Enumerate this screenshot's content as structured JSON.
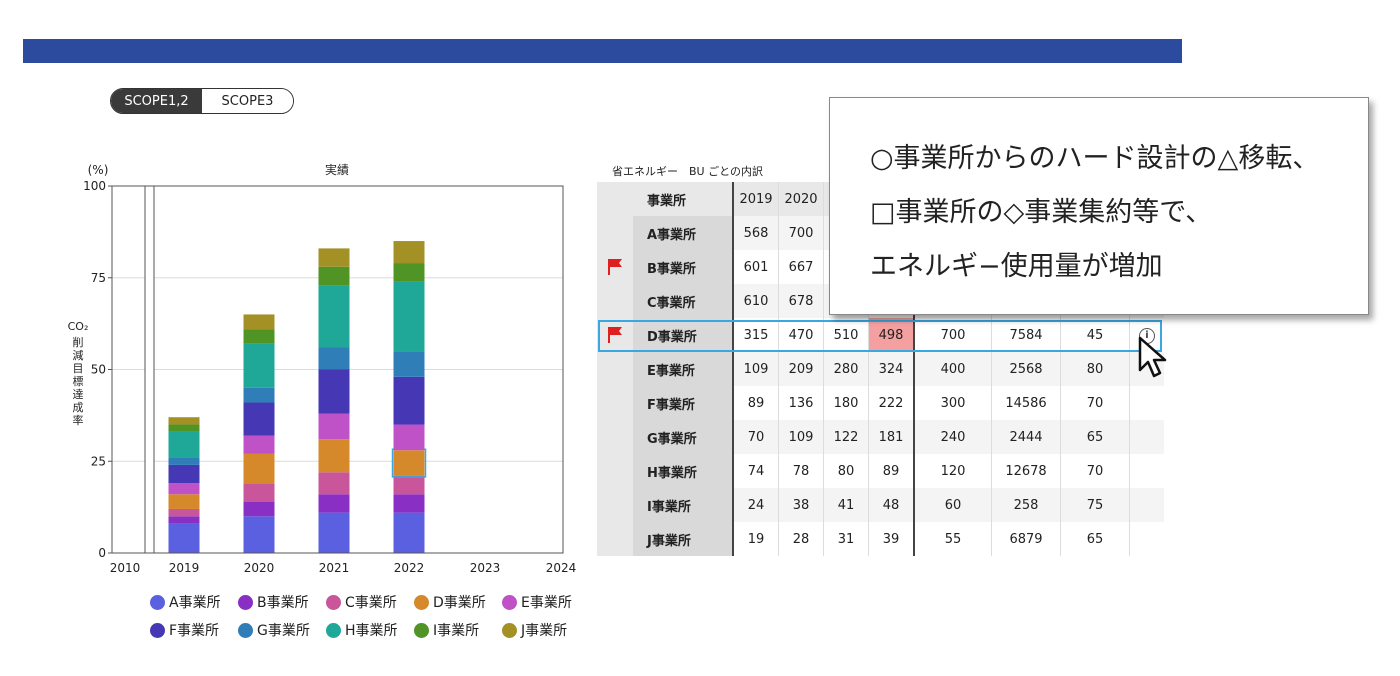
{
  "scope_toggle": {
    "options": [
      "SCOPE1,2",
      "SCOPE3"
    ],
    "selected": "SCOPE1,2"
  },
  "chart_data": {
    "type": "bar",
    "stacked": true,
    "title": "実績",
    "y_unit": "(%)",
    "ylabel": "CO₂ 削減目標達成率",
    "ylim": [
      0,
      100
    ],
    "yticks": [
      0,
      25,
      50,
      75,
      100
    ],
    "x_ticks": [
      "2010",
      "2019",
      "2020",
      "2021",
      "2022",
      "2023",
      "2024"
    ],
    "categories": [
      "2019",
      "2020",
      "2021",
      "2022"
    ],
    "grid": true,
    "legend_position": "bottom",
    "series": [
      {
        "name": "A事業所",
        "color": "#5a60e0",
        "values": [
          8,
          10,
          11,
          11
        ]
      },
      {
        "name": "B事業所",
        "color": "#8a2fc4",
        "values": [
          2,
          4,
          5,
          5
        ]
      },
      {
        "name": "C事業所",
        "color": "#c9559a",
        "values": [
          2,
          5,
          6,
          5
        ]
      },
      {
        "name": "D事業所",
        "color": "#d6892a",
        "values": [
          4,
          8,
          9,
          7
        ]
      },
      {
        "name": "E事業所",
        "color": "#c052c8",
        "values": [
          3,
          5,
          7,
          7
        ]
      },
      {
        "name": "F事業所",
        "color": "#4637b5",
        "values": [
          5,
          9,
          12,
          13
        ]
      },
      {
        "name": "G事業所",
        "color": "#2f7eb8",
        "values": [
          2,
          4,
          6,
          7
        ]
      },
      {
        "name": "H事業所",
        "color": "#1fa897",
        "values": [
          7,
          12,
          17,
          19
        ]
      },
      {
        "name": "I事業所",
        "color": "#4f9425",
        "values": [
          2,
          4,
          5,
          5
        ]
      },
      {
        "name": "J事業所",
        "color": "#a39126",
        "values": [
          2,
          4,
          5,
          6
        ]
      }
    ],
    "highlight": {
      "series": "D事業所",
      "category": "2022",
      "color": "#3aa8e0"
    }
  },
  "table": {
    "title": "省エネルギー　BU ごとの内訳",
    "header_label": "事業所",
    "year_headers": [
      "2019",
      "2020"
    ],
    "rows": [
      {
        "name": "A事業所",
        "flag": false,
        "values": [
          "568",
          "700",
          "",
          "",
          "",
          "",
          ""
        ]
      },
      {
        "name": "B事業所",
        "flag": true,
        "values": [
          "601",
          "667",
          "",
          "",
          "",
          "",
          ""
        ]
      },
      {
        "name": "C事業所",
        "flag": false,
        "values": [
          "610",
          "678",
          "",
          "",
          "",
          "",
          ""
        ]
      },
      {
        "name": "D事業所",
        "flag": true,
        "values": [
          "315",
          "470",
          "510",
          "498",
          "700",
          "7584",
          "45"
        ],
        "highlight_index": 3,
        "info": true
      },
      {
        "name": "E事業所",
        "flag": false,
        "values": [
          "109",
          "209",
          "280",
          "324",
          "400",
          "2568",
          "80"
        ]
      },
      {
        "name": "F事業所",
        "flag": false,
        "values": [
          "89",
          "136",
          "180",
          "222",
          "300",
          "14586",
          "70"
        ]
      },
      {
        "name": "G事業所",
        "flag": false,
        "values": [
          "70",
          "109",
          "122",
          "181",
          "240",
          "2444",
          "65"
        ]
      },
      {
        "name": "H事業所",
        "flag": false,
        "values": [
          "74",
          "78",
          "80",
          "89",
          "120",
          "12678",
          "70"
        ]
      },
      {
        "name": "I事業所",
        "flag": false,
        "values": [
          "24",
          "38",
          "41",
          "48",
          "60",
          "258",
          "75"
        ]
      },
      {
        "name": "J事業所",
        "flag": false,
        "values": [
          "19",
          "28",
          "31",
          "39",
          "55",
          "6879",
          "65"
        ]
      }
    ]
  },
  "callout": {
    "lines": [
      "○事業所からのハード設計の△移転、",
      "□事業所の◇事業集約等で、",
      "エネルギ−使用量が増加"
    ]
  },
  "colors": {
    "top_bar": "#2c4a9e",
    "flag": "#e02020",
    "highlight_cell": "#f4a0a0",
    "row_highlight": "#3aa8e0"
  }
}
